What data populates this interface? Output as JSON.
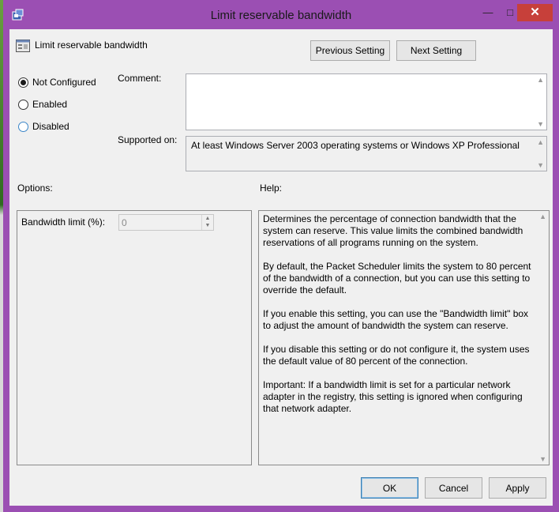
{
  "window": {
    "title": "Limit reservable bandwidth"
  },
  "header": {
    "title": "Limit reservable bandwidth"
  },
  "nav": {
    "previous": "Previous Setting",
    "next": "Next Setting"
  },
  "radios": [
    {
      "label": "Not Configured",
      "selected": true
    },
    {
      "label": "Enabled",
      "selected": false
    },
    {
      "label": "Disabled",
      "selected": false
    }
  ],
  "comment": {
    "label": "Comment:",
    "value": ""
  },
  "supported": {
    "label": "Supported on:",
    "value": "At least Windows Server 2003 operating systems or Windows XP Professional"
  },
  "options": {
    "label": "Options:",
    "field_label": "Bandwidth limit (%):",
    "field_value": "0"
  },
  "help": {
    "label": "Help:",
    "paragraphs": [
      "Determines the percentage of connection bandwidth that the system can reserve. This value limits the combined bandwidth reservations of all programs running on the system.",
      "By default, the Packet Scheduler limits the system to 80 percent of the bandwidth of a connection, but you can use this setting to override the default.",
      "If you enable this setting, you can use the \"Bandwidth limit\" box to adjust the amount of bandwidth the system can reserve.",
      "If you disable this setting or do not configure it, the system uses the default value of 80 percent of the connection.",
      "Important: If a bandwidth limit is set for a particular network adapter in the registry, this setting is ignored when configuring that network adapter."
    ]
  },
  "footer": {
    "ok": "OK",
    "cancel": "Cancel",
    "apply": "Apply"
  },
  "colors": {
    "titlebar": "#9b4fb3",
    "close": "#c7403a",
    "client": "#f0f0f0"
  },
  "icons": {
    "app": "policy-app-icon",
    "setting": "policy-setting-icon"
  }
}
